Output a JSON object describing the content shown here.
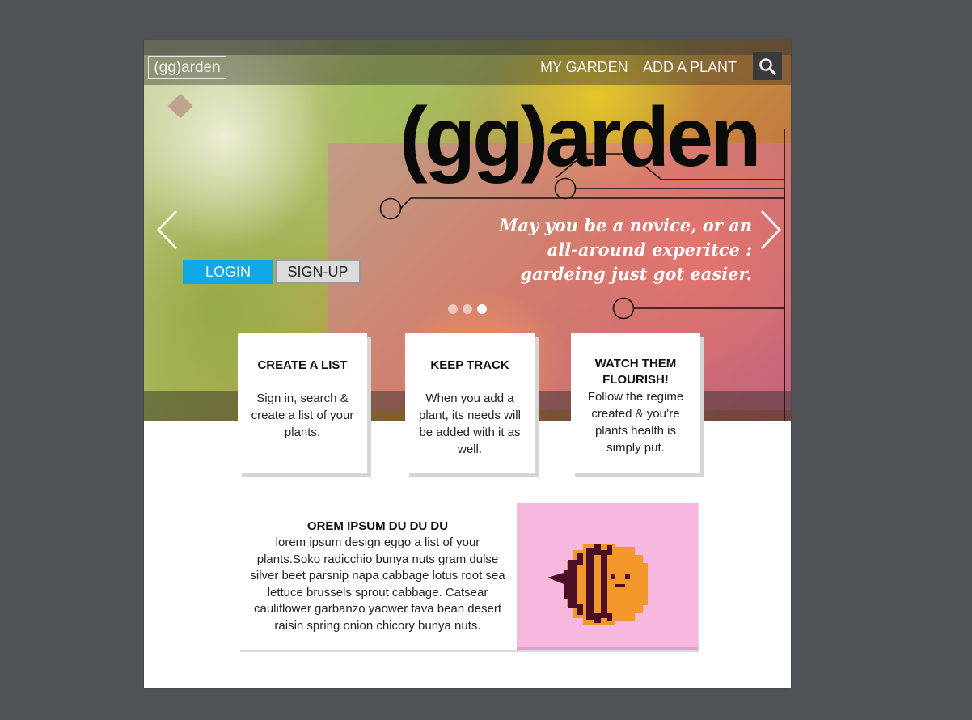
{
  "header": {
    "logo": "(gg)arden",
    "nav": [
      {
        "label": "MY GARDEN"
      },
      {
        "label": "ADD A PLANT"
      }
    ],
    "search_icon": "search-icon"
  },
  "hero": {
    "title": "(gg)arden",
    "tagline_lines": [
      "May you be a novice, or an",
      "all-around experitce :",
      "gardeing just got easier."
    ],
    "prev_icon": "chevron-left-icon",
    "next_icon": "chevron-right-icon",
    "login_label": "LOGIN",
    "signup_label": "SIGN-UP",
    "carousel_slides": 3,
    "carousel_active_index": 2
  },
  "features": [
    {
      "title": "CREATE A LIST",
      "body": "Sign in, search & create a list of your plants."
    },
    {
      "title": "KEEP TRACK",
      "body": "When you add a plant, its needs will be added with it as well."
    },
    {
      "title": "WATCH THEM FLOURISH!",
      "body": "Follow the regime created & you’re plants health is simply put."
    }
  ],
  "info": {
    "title": "OREM IPSUM DU DU DU",
    "body": "lorem ipsum design eggo a list of your plants.Soko radicchio bunya nuts gram dulse silver beet parsnip napa cabbage lotus root sea lettuce brussels sprout cabbage. Catsear cauliflower garbanzo yaower fava bean desert raisin spring onion chicory bunya nuts.",
    "image_icon": "pixel-bee-icon"
  },
  "colors": {
    "page_bg": "#505356",
    "login_blue": "#11a8e8",
    "pink_overlay": "#e16eaa",
    "bee_bg": "#f6b8df",
    "bee_orange": "#f3972a",
    "bee_stripe": "#4a0f26"
  }
}
